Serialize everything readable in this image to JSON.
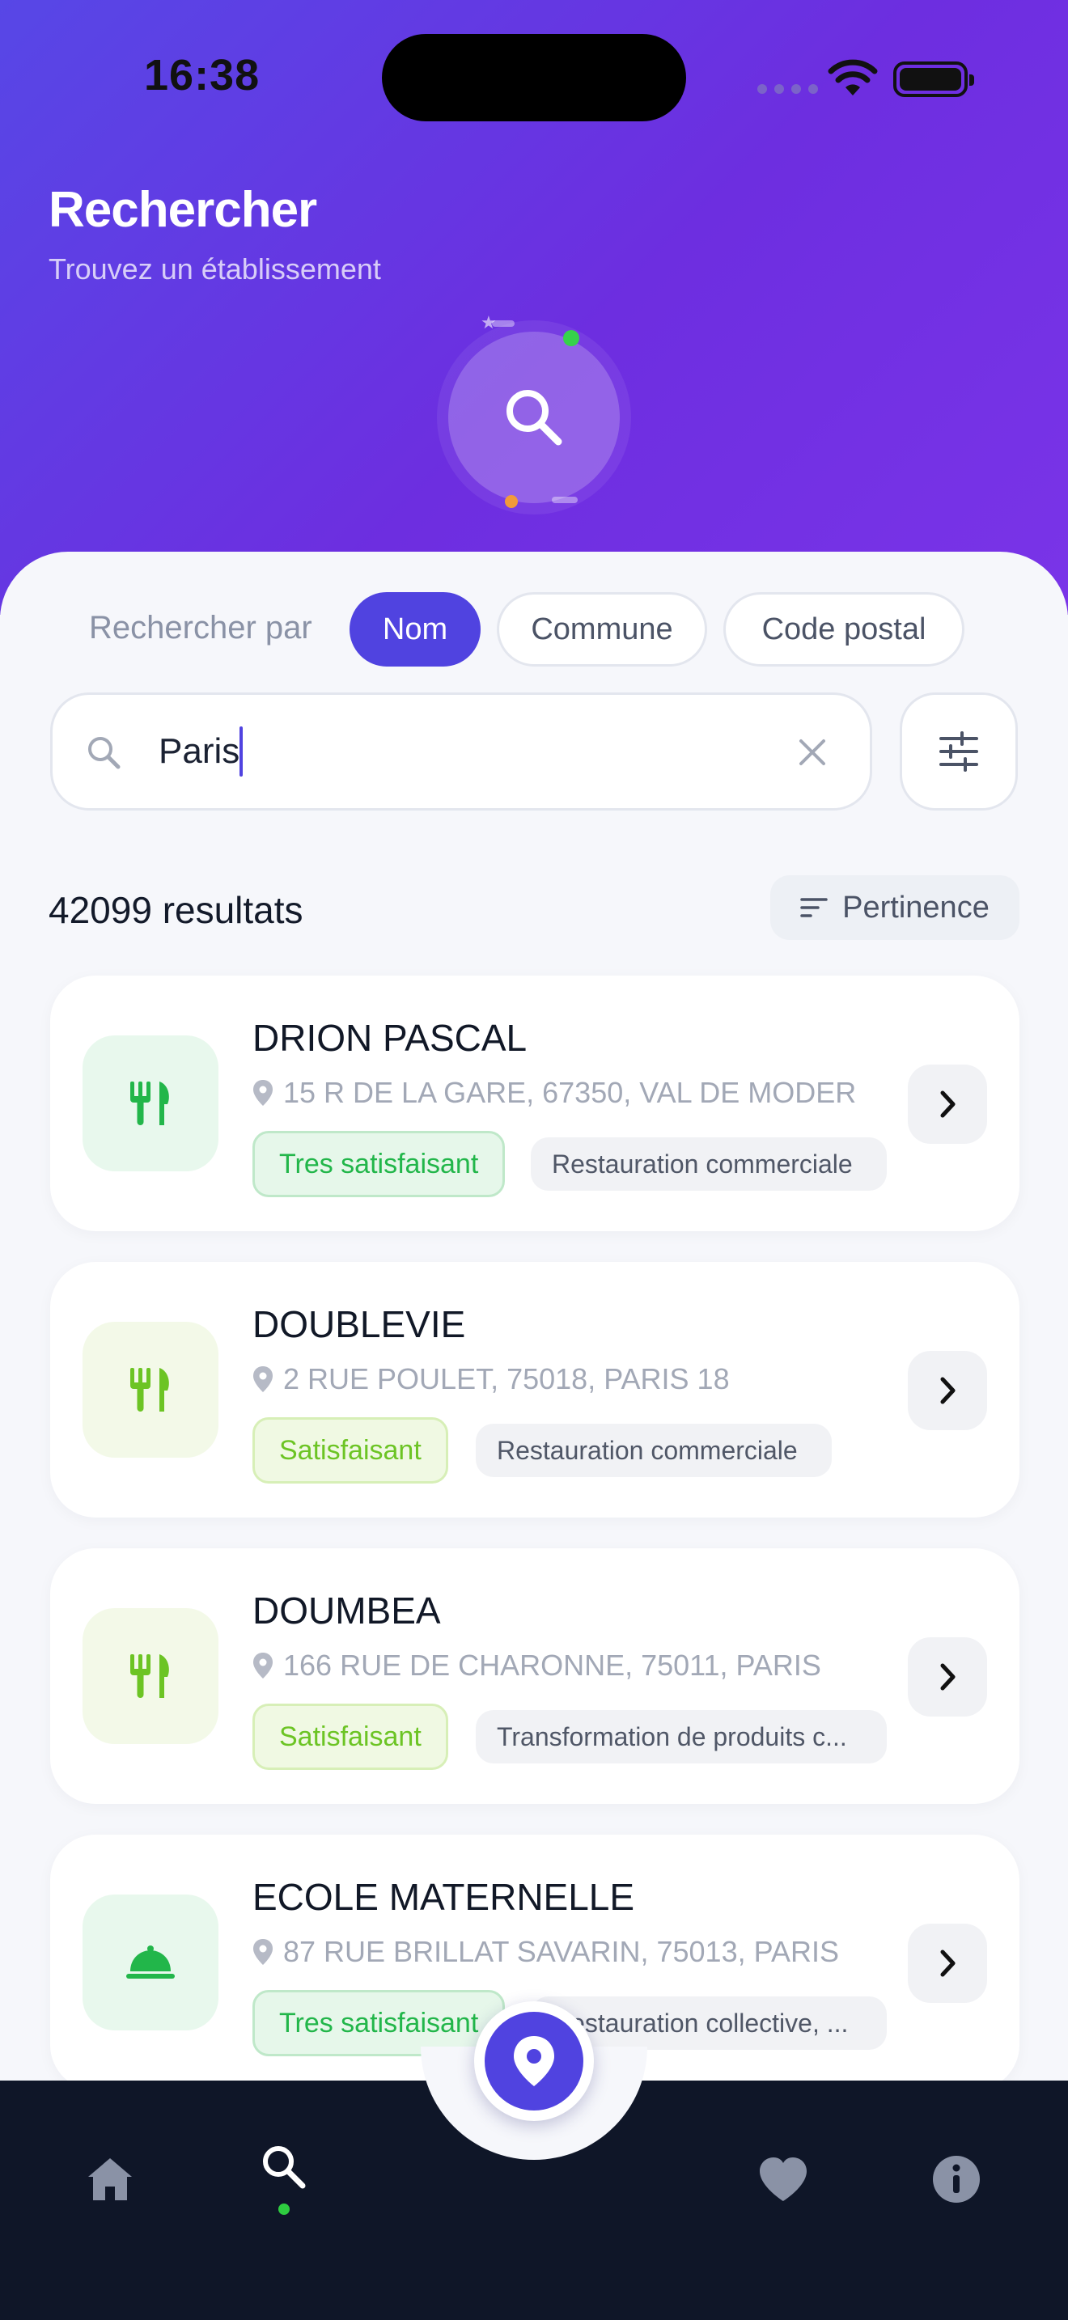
{
  "status_bar": {
    "time": "16:38"
  },
  "header": {
    "title": "Rechercher",
    "subtitle": "Trouvez un établissement"
  },
  "search_by": {
    "label": "Rechercher par",
    "options": [
      {
        "label": "Nom",
        "active": true
      },
      {
        "label": "Commune",
        "active": false
      },
      {
        "label": "Code postal",
        "active": false
      }
    ]
  },
  "search": {
    "value": "Paris"
  },
  "results": {
    "count_label": "42099 resultats",
    "sort_label": "Pertinence"
  },
  "establishments": [
    {
      "name": "DRION PASCAL",
      "address": "15 R  DE LA GARE, 67350, VAL DE MODER",
      "rating": "Tres satisfaisant",
      "category": "Restauration commerciale",
      "icon": "fork-knife-icon"
    },
    {
      "name": "DOUBLEVIE",
      "address": "2 RUE POULET, 75018, PARIS 18",
      "rating": "Satisfaisant",
      "category": "Restauration commerciale",
      "icon": "fork-knife-icon"
    },
    {
      "name": "DOUMBEA",
      "address": "166 RUE DE CHARONNE, 75011, PARIS",
      "rating": "Satisfaisant",
      "category": "Transformation de produits c...",
      "icon": "fork-knife-icon"
    },
    {
      "name": "ECOLE MATERNELLE",
      "address": "87 RUE BRILLAT SAVARIN, 75013, PARIS",
      "rating": "Tres satisfaisant",
      "category": "Restauration collective, ...",
      "icon": "cloche-icon"
    }
  ],
  "colors": {
    "primary": "#5043e0",
    "very_good": "#22b64a",
    "good": "#6cc424",
    "nav_bg": "#0f1628"
  },
  "nav": {
    "active": "search"
  }
}
